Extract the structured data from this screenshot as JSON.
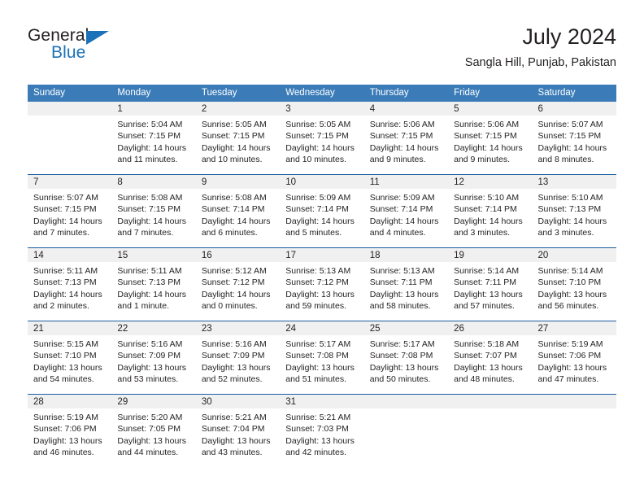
{
  "brand": {
    "name_part1": "General",
    "name_part2": "Blue",
    "triangle_color": "#1b72b8"
  },
  "header": {
    "title": "July 2024",
    "subtitle": "Sangla Hill, Punjab, Pakistan"
  },
  "theme": {
    "header_bar": "#3b7cb8",
    "row_separator": "#1b5fa0",
    "daynum_bg": "#f0f0f0",
    "text": "#231f20"
  },
  "weekdays": [
    "Sunday",
    "Monday",
    "Tuesday",
    "Wednesday",
    "Thursday",
    "Friday",
    "Saturday"
  ],
  "weeks": [
    [
      {
        "day": "",
        "sunrise": "",
        "sunset": "",
        "daylight1": "",
        "daylight2": "",
        "empty": true
      },
      {
        "day": "1",
        "sunrise": "Sunrise: 5:04 AM",
        "sunset": "Sunset: 7:15 PM",
        "daylight1": "Daylight: 14 hours",
        "daylight2": "and 11 minutes."
      },
      {
        "day": "2",
        "sunrise": "Sunrise: 5:05 AM",
        "sunset": "Sunset: 7:15 PM",
        "daylight1": "Daylight: 14 hours",
        "daylight2": "and 10 minutes."
      },
      {
        "day": "3",
        "sunrise": "Sunrise: 5:05 AM",
        "sunset": "Sunset: 7:15 PM",
        "daylight1": "Daylight: 14 hours",
        "daylight2": "and 10 minutes."
      },
      {
        "day": "4",
        "sunrise": "Sunrise: 5:06 AM",
        "sunset": "Sunset: 7:15 PM",
        "daylight1": "Daylight: 14 hours",
        "daylight2": "and 9 minutes."
      },
      {
        "day": "5",
        "sunrise": "Sunrise: 5:06 AM",
        "sunset": "Sunset: 7:15 PM",
        "daylight1": "Daylight: 14 hours",
        "daylight2": "and 9 minutes."
      },
      {
        "day": "6",
        "sunrise": "Sunrise: 5:07 AM",
        "sunset": "Sunset: 7:15 PM",
        "daylight1": "Daylight: 14 hours",
        "daylight2": "and 8 minutes."
      }
    ],
    [
      {
        "day": "7",
        "sunrise": "Sunrise: 5:07 AM",
        "sunset": "Sunset: 7:15 PM",
        "daylight1": "Daylight: 14 hours",
        "daylight2": "and 7 minutes."
      },
      {
        "day": "8",
        "sunrise": "Sunrise: 5:08 AM",
        "sunset": "Sunset: 7:15 PM",
        "daylight1": "Daylight: 14 hours",
        "daylight2": "and 7 minutes."
      },
      {
        "day": "9",
        "sunrise": "Sunrise: 5:08 AM",
        "sunset": "Sunset: 7:14 PM",
        "daylight1": "Daylight: 14 hours",
        "daylight2": "and 6 minutes."
      },
      {
        "day": "10",
        "sunrise": "Sunrise: 5:09 AM",
        "sunset": "Sunset: 7:14 PM",
        "daylight1": "Daylight: 14 hours",
        "daylight2": "and 5 minutes."
      },
      {
        "day": "11",
        "sunrise": "Sunrise: 5:09 AM",
        "sunset": "Sunset: 7:14 PM",
        "daylight1": "Daylight: 14 hours",
        "daylight2": "and 4 minutes."
      },
      {
        "day": "12",
        "sunrise": "Sunrise: 5:10 AM",
        "sunset": "Sunset: 7:14 PM",
        "daylight1": "Daylight: 14 hours",
        "daylight2": "and 3 minutes."
      },
      {
        "day": "13",
        "sunrise": "Sunrise: 5:10 AM",
        "sunset": "Sunset: 7:13 PM",
        "daylight1": "Daylight: 14 hours",
        "daylight2": "and 3 minutes."
      }
    ],
    [
      {
        "day": "14",
        "sunrise": "Sunrise: 5:11 AM",
        "sunset": "Sunset: 7:13 PM",
        "daylight1": "Daylight: 14 hours",
        "daylight2": "and 2 minutes."
      },
      {
        "day": "15",
        "sunrise": "Sunrise: 5:11 AM",
        "sunset": "Sunset: 7:13 PM",
        "daylight1": "Daylight: 14 hours",
        "daylight2": "and 1 minute."
      },
      {
        "day": "16",
        "sunrise": "Sunrise: 5:12 AM",
        "sunset": "Sunset: 7:12 PM",
        "daylight1": "Daylight: 14 hours",
        "daylight2": "and 0 minutes."
      },
      {
        "day": "17",
        "sunrise": "Sunrise: 5:13 AM",
        "sunset": "Sunset: 7:12 PM",
        "daylight1": "Daylight: 13 hours",
        "daylight2": "and 59 minutes."
      },
      {
        "day": "18",
        "sunrise": "Sunrise: 5:13 AM",
        "sunset": "Sunset: 7:11 PM",
        "daylight1": "Daylight: 13 hours",
        "daylight2": "and 58 minutes."
      },
      {
        "day": "19",
        "sunrise": "Sunrise: 5:14 AM",
        "sunset": "Sunset: 7:11 PM",
        "daylight1": "Daylight: 13 hours",
        "daylight2": "and 57 minutes."
      },
      {
        "day": "20",
        "sunrise": "Sunrise: 5:14 AM",
        "sunset": "Sunset: 7:10 PM",
        "daylight1": "Daylight: 13 hours",
        "daylight2": "and 56 minutes."
      }
    ],
    [
      {
        "day": "21",
        "sunrise": "Sunrise: 5:15 AM",
        "sunset": "Sunset: 7:10 PM",
        "daylight1": "Daylight: 13 hours",
        "daylight2": "and 54 minutes."
      },
      {
        "day": "22",
        "sunrise": "Sunrise: 5:16 AM",
        "sunset": "Sunset: 7:09 PM",
        "daylight1": "Daylight: 13 hours",
        "daylight2": "and 53 minutes."
      },
      {
        "day": "23",
        "sunrise": "Sunrise: 5:16 AM",
        "sunset": "Sunset: 7:09 PM",
        "daylight1": "Daylight: 13 hours",
        "daylight2": "and 52 minutes."
      },
      {
        "day": "24",
        "sunrise": "Sunrise: 5:17 AM",
        "sunset": "Sunset: 7:08 PM",
        "daylight1": "Daylight: 13 hours",
        "daylight2": "and 51 minutes."
      },
      {
        "day": "25",
        "sunrise": "Sunrise: 5:17 AM",
        "sunset": "Sunset: 7:08 PM",
        "daylight1": "Daylight: 13 hours",
        "daylight2": "and 50 minutes."
      },
      {
        "day": "26",
        "sunrise": "Sunrise: 5:18 AM",
        "sunset": "Sunset: 7:07 PM",
        "daylight1": "Daylight: 13 hours",
        "daylight2": "and 48 minutes."
      },
      {
        "day": "27",
        "sunrise": "Sunrise: 5:19 AM",
        "sunset": "Sunset: 7:06 PM",
        "daylight1": "Daylight: 13 hours",
        "daylight2": "and 47 minutes."
      }
    ],
    [
      {
        "day": "28",
        "sunrise": "Sunrise: 5:19 AM",
        "sunset": "Sunset: 7:06 PM",
        "daylight1": "Daylight: 13 hours",
        "daylight2": "and 46 minutes."
      },
      {
        "day": "29",
        "sunrise": "Sunrise: 5:20 AM",
        "sunset": "Sunset: 7:05 PM",
        "daylight1": "Daylight: 13 hours",
        "daylight2": "and 44 minutes."
      },
      {
        "day": "30",
        "sunrise": "Sunrise: 5:21 AM",
        "sunset": "Sunset: 7:04 PM",
        "daylight1": "Daylight: 13 hours",
        "daylight2": "and 43 minutes."
      },
      {
        "day": "31",
        "sunrise": "Sunrise: 5:21 AM",
        "sunset": "Sunset: 7:03 PM",
        "daylight1": "Daylight: 13 hours",
        "daylight2": "and 42 minutes."
      },
      {
        "day": "",
        "sunrise": "",
        "sunset": "",
        "daylight1": "",
        "daylight2": "",
        "empty": true
      },
      {
        "day": "",
        "sunrise": "",
        "sunset": "",
        "daylight1": "",
        "daylight2": "",
        "empty": true
      },
      {
        "day": "",
        "sunrise": "",
        "sunset": "",
        "daylight1": "",
        "daylight2": "",
        "empty": true
      }
    ]
  ]
}
